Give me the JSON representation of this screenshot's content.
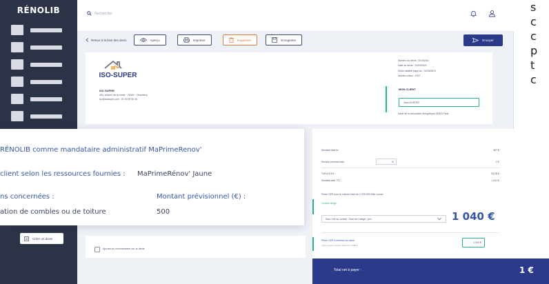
{
  "app": {
    "logo": "RÉNOLIB"
  },
  "topbar": {
    "search_placeholder": "Rechercher"
  },
  "toolbar": {
    "back_label": "Retour à la liste des devis",
    "preview_label": "Aperçu",
    "print_label": "Imprimer",
    "delete_label": "Supprimer",
    "save_label": "Enregistrer",
    "send_label": "Envoyer"
  },
  "company": {
    "logo_text": "ISO-SUPER",
    "name": "ISO SUPER",
    "address": "454, chemin de la ronde · 73000 · Chambéry",
    "contact": "iso@isosuper.com · 01 00 00 00 00"
  },
  "devis": {
    "numero": "Numéro du devis : D143ZAA",
    "date": "Date du devis : 01/03/2021",
    "validite": "Devis valable jusqu'au : 01/03/2021",
    "client_num": "Numéro client : 1297"
  },
  "client": {
    "label": "MON CLIENT",
    "name": "Jean DURONT",
    "note": "Issue de la rénovation énergétique 15000 Paris"
  },
  "overlay": {
    "line1": "RÉNOLIB comme mandataire administratif MaPrimeRenov'",
    "line2_label": "client selon les ressources fournies :",
    "line2_value": "MaPrimeRénov' Jaune",
    "col1_header": "ns concernées :",
    "col2_header": "Montant prévisionnel (€) :",
    "row_label": "ation de combles ou de toiture",
    "row_value": "500"
  },
  "create_button": "Créer un devis",
  "comment_label": "Ajouter un commentaire sur le devis",
  "totals": {
    "ht_label": "Montant total ht :",
    "ht_value": "987 €",
    "discount_label": "Remise commerciale :",
    "discount_unit": "%",
    "discount_value": "- 0 €",
    "tva_label": "TVA à 5,5% :",
    "tva_value": "54,28 €",
    "ttc_label": "Montant total TTC :",
    "ttc_value": "1 041 €",
    "prime_note": "Prime CEE pour le volume total de 2 078 000 kWh cumac",
    "contract_label": "Contrat obligé",
    "contract_select": "Nom / réf du contrat - Nom de l'obligé - prix",
    "big_amount": "1 040 €",
    "cee_label": "Prime CEE à reverser au client",
    "cee_sub": "Vous pouvez reverser entre 0 et 1040 €",
    "cee_value": "1 040 €"
  },
  "net": {
    "label": "Total net à payer :",
    "value": "1 €"
  },
  "side_text": [
    "s",
    "c",
    "c",
    "p",
    "t",
    "c"
  ]
}
